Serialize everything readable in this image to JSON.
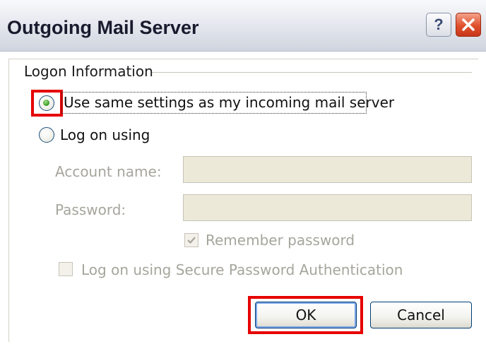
{
  "window": {
    "title": "Outgoing Mail Server",
    "help_glyph": "?",
    "close_glyph": "×"
  },
  "logon": {
    "group_label": "Logon Information",
    "option_same_label": "Use same settings as my incoming mail server",
    "option_same_selected": true,
    "option_logon_label": "Log on using",
    "option_logon_selected": false,
    "account_name_label": "Account name:",
    "account_name_value": "",
    "password_label": "Password:",
    "password_value": "",
    "remember_password_label": "Remember password",
    "remember_password_checked": true,
    "spa_label": "Log on using Secure Password Authentication",
    "spa_checked": false
  },
  "buttons": {
    "ok_label": "OK",
    "cancel_label": "Cancel"
  },
  "colors": {
    "highlight": "#e60000",
    "disabled_text": "#a6a59c"
  },
  "icons": [
    "help-icon",
    "close-icon",
    "radio-selected-icon",
    "radio-unselected-icon",
    "checkmark-icon"
  ]
}
